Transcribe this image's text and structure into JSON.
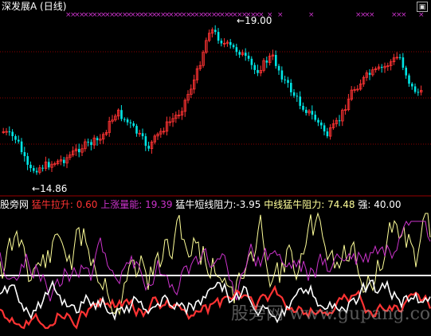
{
  "header": {
    "title": "深发展A (日线)",
    "config_icon": "settings-icon"
  },
  "price_chart": {
    "high_label": "19.00",
    "low_label": "14.86",
    "up_color": "#ff3333",
    "down_color": "#00e5e5",
    "marker_color": "#cc33cc",
    "grid_color": "#8b0000"
  },
  "indicator": {
    "name": "股旁网",
    "items": [
      {
        "label": "猛牛拉升:",
        "value": "0.60",
        "color": "#ff3333"
      },
      {
        "label": "上涨量能:",
        "value": "19.39",
        "color": "#cc33cc"
      },
      {
        "label": "猛牛短线阻力:",
        "value": "-3.95",
        "color": "#ffffff"
      },
      {
        "label": "中线猛牛阻力:",
        "value": "74.48",
        "color": "#ffff99"
      },
      {
        "label": "强:",
        "value": "40.00",
        "color": "#ffffff"
      }
    ]
  },
  "watermark": "股旁网 www.gupang.com"
}
